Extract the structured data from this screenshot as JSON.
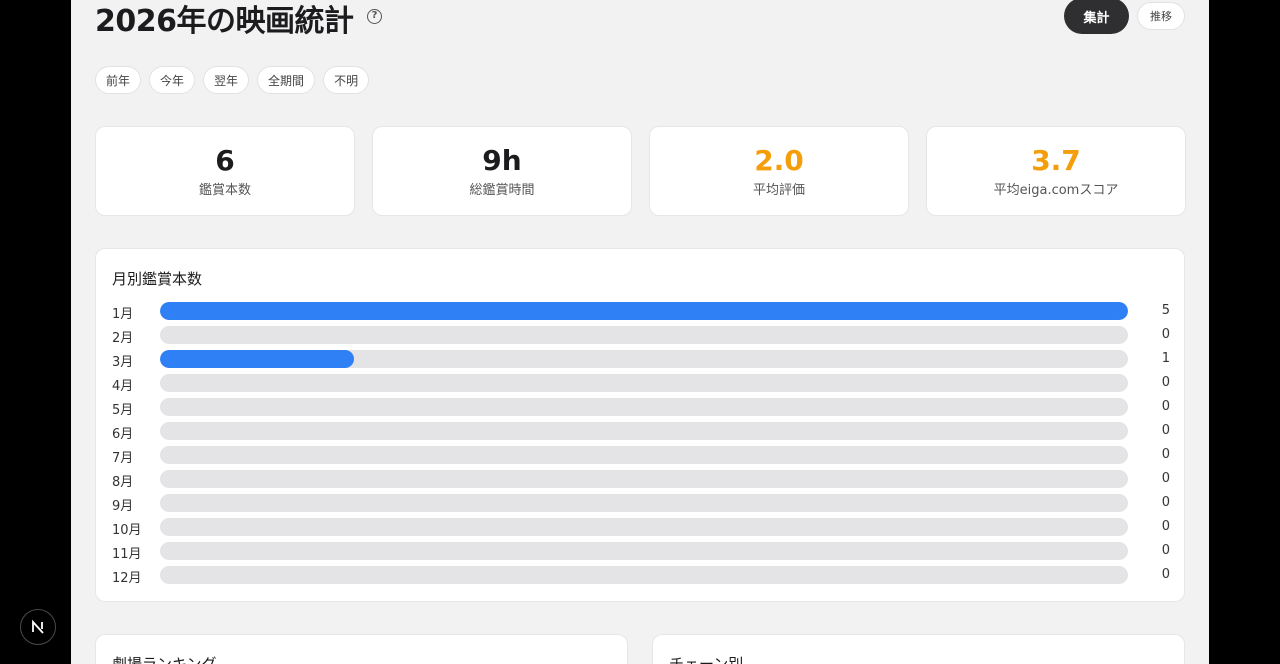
{
  "header": {
    "title": "2026年の映画統計",
    "help_icon": "question-circle-icon",
    "view_active": "集計",
    "view_inactive": "推移"
  },
  "filters": [
    "前年",
    "今年",
    "翌年",
    "全期間",
    "不明"
  ],
  "stats": [
    {
      "value": "6",
      "label": "鑑賞本数",
      "color": "#1c1c1e"
    },
    {
      "value": "9h",
      "label": "総鑑賞時間",
      "color": "#1c1c1e"
    },
    {
      "value": "2.0",
      "label": "平均評価",
      "color": "#f59e0b"
    },
    {
      "value": "3.7",
      "label": "平均eiga.comスコア",
      "color": "#f59e0b"
    }
  ],
  "monthly": {
    "title": "月別鑑賞本数",
    "bar_color": "#2f80f5"
  },
  "chart_data": {
    "type": "bar",
    "title": "月別鑑賞本数",
    "orientation": "horizontal",
    "categories": [
      "1月",
      "2月",
      "3月",
      "4月",
      "5月",
      "6月",
      "7月",
      "8月",
      "9月",
      "10月",
      "11月",
      "12月"
    ],
    "values": [
      5,
      0,
      1,
      0,
      0,
      0,
      0,
      0,
      0,
      0,
      0,
      0
    ],
    "xlim": [
      0,
      5
    ]
  },
  "bottom": {
    "left_title": "劇場ランキング",
    "right_title": "チェーン別"
  },
  "badge": {
    "letter": "N",
    "icon": "nextjs-logo-icon"
  }
}
